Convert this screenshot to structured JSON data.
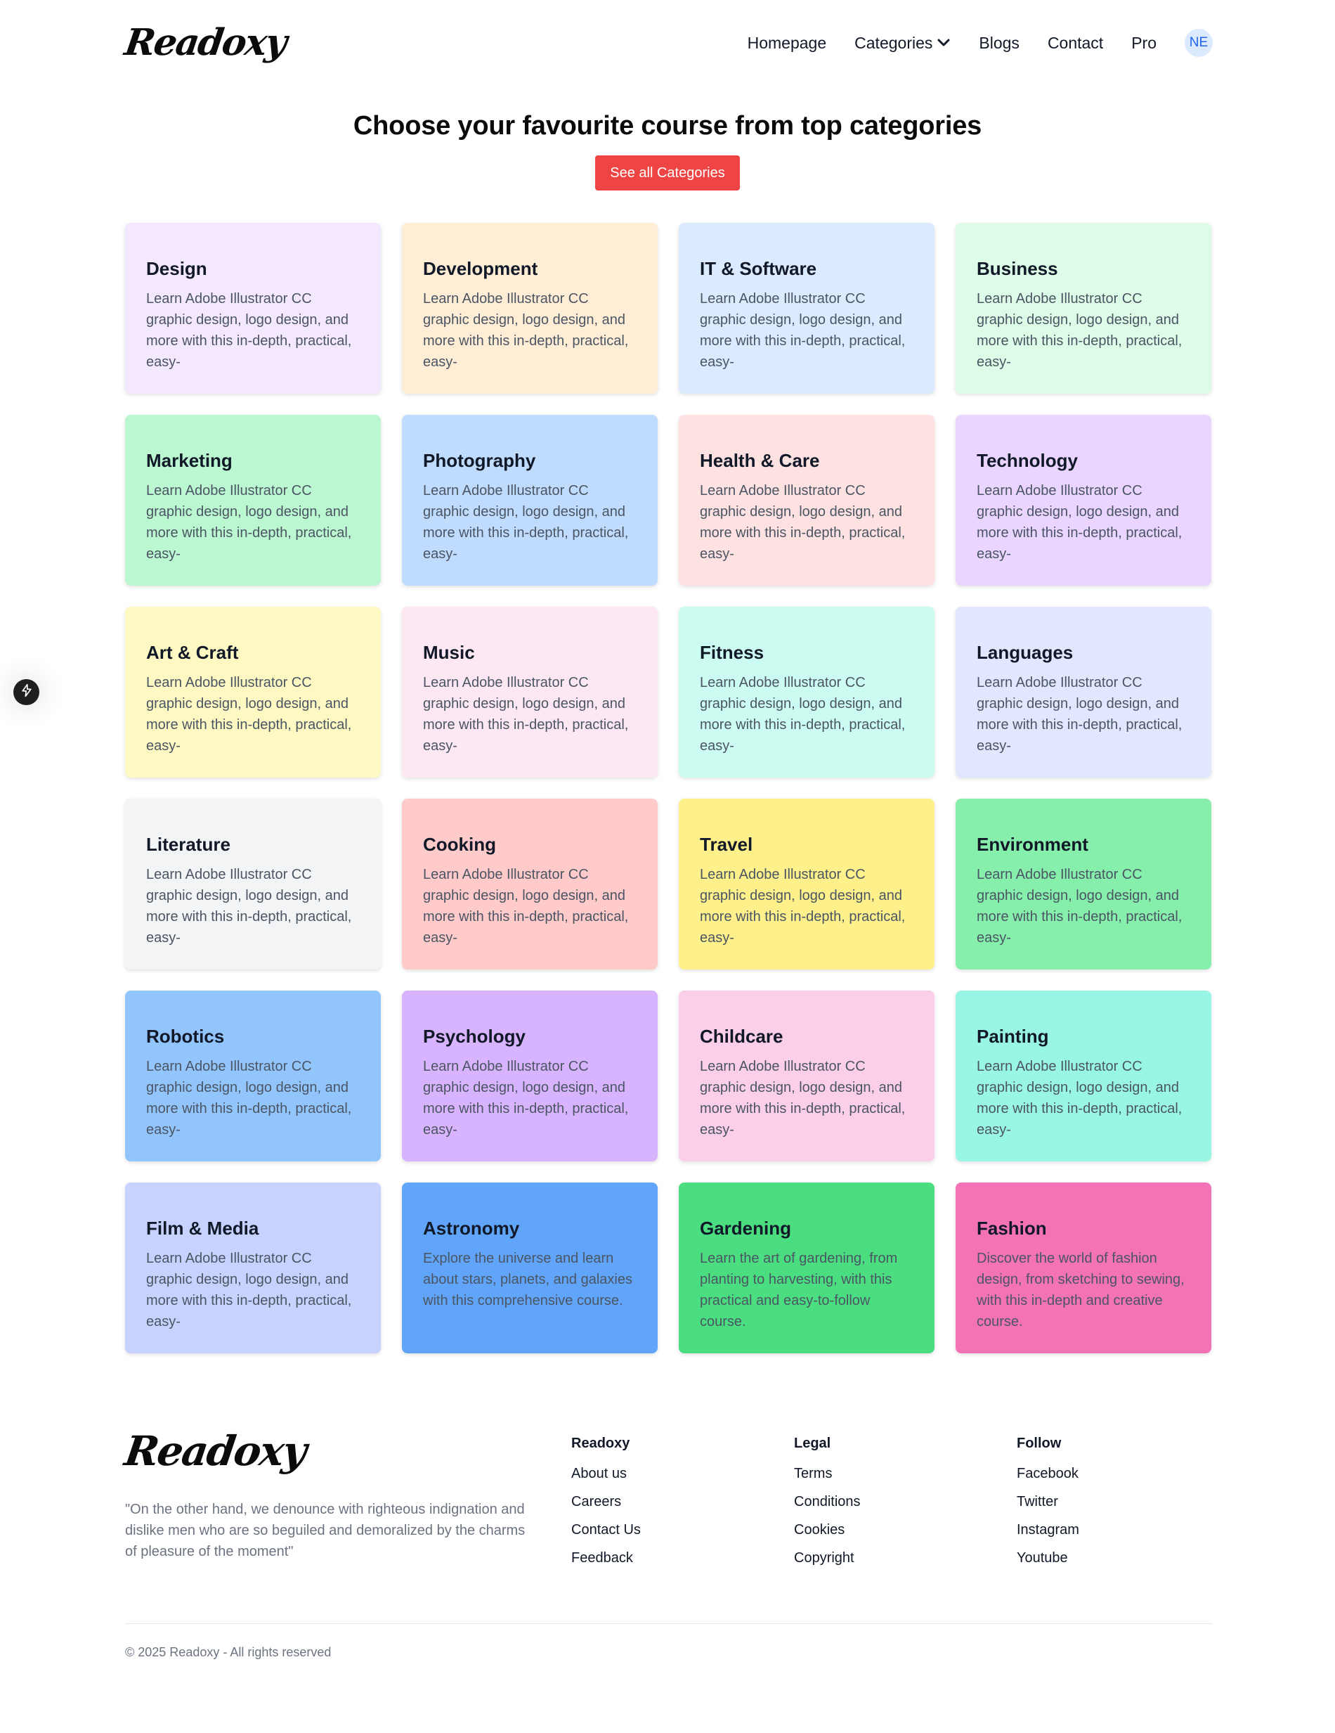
{
  "header": {
    "logo_text": "Readoxy",
    "nav": [
      {
        "label": "Homepage"
      },
      {
        "label": "Categories"
      },
      {
        "label": "Blogs"
      },
      {
        "label": "Contact"
      },
      {
        "label": "Pro"
      }
    ],
    "avatar_initials": "NE"
  },
  "hero": {
    "title": "Choose your favourite course from top categories",
    "button_label": "See all Categories"
  },
  "categories": [
    {
      "title": "Design",
      "desc": "Learn Adobe Illustrator CC graphic design, logo design, and more with this in-depth, practical, easy-",
      "color": "#f3e8ff"
    },
    {
      "title": "Development",
      "desc": "Learn Adobe Illustrator CC graphic design, logo design, and more with this in-depth, practical, easy-",
      "color": "#ffedd5"
    },
    {
      "title": "IT & Software",
      "desc": "Learn Adobe Illustrator CC graphic design, logo design, and more with this in-depth, practical, easy-",
      "color": "#dbeafe"
    },
    {
      "title": "Business",
      "desc": "Learn Adobe Illustrator CC graphic design, logo design, and more with this in-depth, practical, easy-",
      "color": "#dcfce7"
    },
    {
      "title": "Marketing",
      "desc": "Learn Adobe Illustrator CC graphic design, logo design, and more with this in-depth, practical, easy-",
      "color": "#bbf7d0"
    },
    {
      "title": "Photography",
      "desc": "Learn Adobe Illustrator CC graphic design, logo design, and more with this in-depth, practical, easy-",
      "color": "#bfdbfe"
    },
    {
      "title": "Health & Care",
      "desc": "Learn Adobe Illustrator CC graphic design, logo design, and more with this in-depth, practical, easy-",
      "color": "#fee2e2"
    },
    {
      "title": "Technology",
      "desc": "Learn Adobe Illustrator CC graphic design, logo design, and more with this in-depth, practical, easy-",
      "color": "#e9d5ff"
    },
    {
      "title": "Art & Craft",
      "desc": "Learn Adobe Illustrator CC graphic design, logo design, and more with this in-depth, practical, easy-",
      "color": "#fef9c3"
    },
    {
      "title": "Music",
      "desc": "Learn Adobe Illustrator CC graphic design, logo design, and more with this in-depth, practical, easy-",
      "color": "#fce7f3"
    },
    {
      "title": "Fitness",
      "desc": "Learn Adobe Illustrator CC graphic design, logo design, and more with this in-depth, practical, easy-",
      "color": "#ccfbf1"
    },
    {
      "title": "Languages",
      "desc": "Learn Adobe Illustrator CC graphic design, logo design, and more with this in-depth, practical, easy-",
      "color": "#e0e7ff"
    },
    {
      "title": "Literature",
      "desc": "Learn Adobe Illustrator CC graphic design, logo design, and more with this in-depth, practical, easy-",
      "color": "#f3f4f6"
    },
    {
      "title": "Cooking",
      "desc": "Learn Adobe Illustrator CC graphic design, logo design, and more with this in-depth, practical, easy-",
      "color": "#fecaca"
    },
    {
      "title": "Travel",
      "desc": "Learn Adobe Illustrator CC graphic design, logo design, and more with this in-depth, practical, easy-",
      "color": "#fef08a"
    },
    {
      "title": "Environment",
      "desc": "Learn Adobe Illustrator CC graphic design, logo design, and more with this in-depth, practical, easy-",
      "color": "#86efac"
    },
    {
      "title": "Robotics",
      "desc": "Learn Adobe Illustrator CC graphic design, logo design, and more with this in-depth, practical, easy-",
      "color": "#93c5fd"
    },
    {
      "title": "Psychology",
      "desc": "Learn Adobe Illustrator CC graphic design, logo design, and more with this in-depth, practical, easy-",
      "color": "#d8b4fe"
    },
    {
      "title": "Childcare",
      "desc": "Learn Adobe Illustrator CC graphic design, logo design, and more with this in-depth, practical, easy-",
      "color": "#fbcfe8"
    },
    {
      "title": "Painting",
      "desc": "Learn Adobe Illustrator CC graphic design, logo design, and more with this in-depth, practical, easy-",
      "color": "#99f6e4"
    },
    {
      "title": "Film & Media",
      "desc": "Learn Adobe Illustrator CC graphic design, logo design, and more with this in-depth, practical, easy-",
      "color": "#c7d2fe"
    },
    {
      "title": "Astronomy",
      "desc": "Explore the universe and learn about stars, planets, and galaxies with this comprehensive course.",
      "color": "#60a5fa"
    },
    {
      "title": "Gardening",
      "desc": "Learn the art of gardening, from planting to harvesting, with this practical and easy-to-follow course.",
      "color": "#4ade80"
    },
    {
      "title": "Fashion",
      "desc": "Discover the world of fashion design, from sketching to sewing, with this in-depth and creative course.",
      "color": "#f472b6"
    }
  ],
  "footer": {
    "logo_text": "Readoxy",
    "quote": "\"On the other hand, we denounce with righteous indignation and dislike men who are so beguiled and demoralized by the charms of pleasure of the moment\"",
    "columns": [
      {
        "title": "Readoxy",
        "links": [
          "About us",
          "Careers",
          "Contact Us",
          "Feedback"
        ]
      },
      {
        "title": "Legal",
        "links": [
          "Terms",
          "Conditions",
          "Cookies",
          "Copyright"
        ]
      },
      {
        "title": "Follow",
        "links": [
          "Facebook",
          "Twitter",
          "Instagram",
          "Youtube"
        ]
      }
    ],
    "copyright": "© 2025 Readoxy - All rights reserved"
  },
  "icons": {
    "nav_dropdown": "chevron-down-icon",
    "floating_button": "lightning-icon"
  },
  "colors": {
    "accent": "#ef4444",
    "avatar_bg": "#dbeafe",
    "avatar_text": "#2563eb"
  }
}
